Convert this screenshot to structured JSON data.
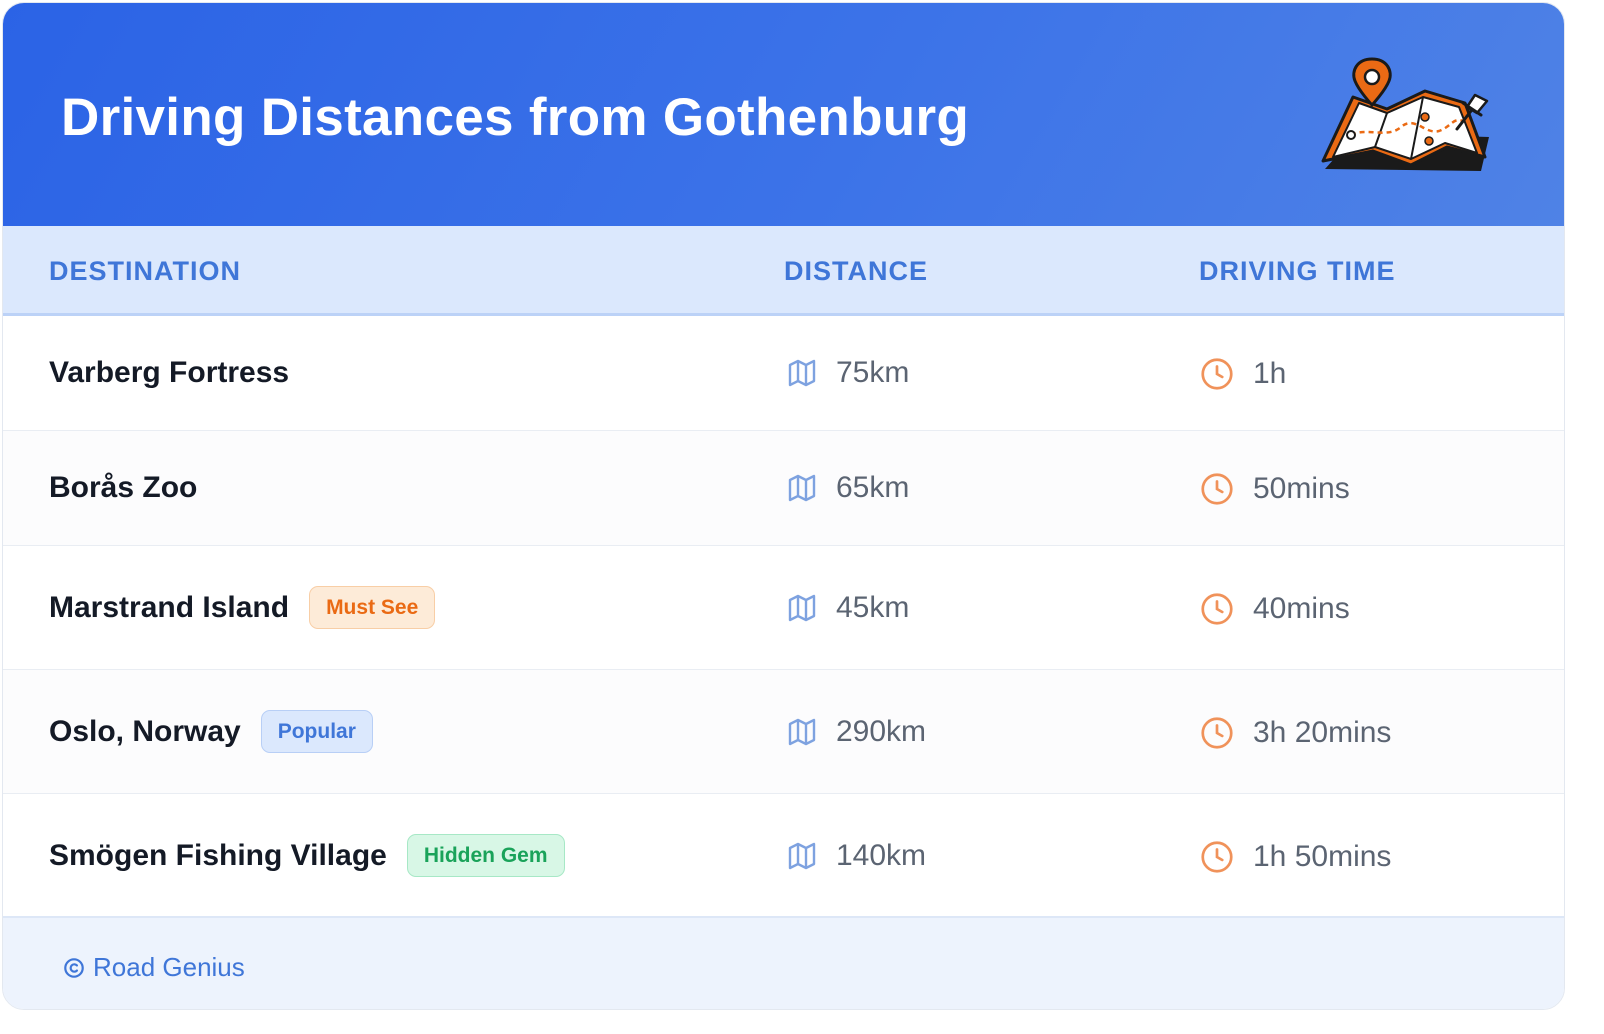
{
  "header": {
    "title": "Driving Distances from Gothenburg",
    "illustration": "map-with-pin-icon"
  },
  "table": {
    "columns": [
      "DESTINATION",
      "DISTANCE",
      "DRIVING TIME"
    ],
    "rows": [
      {
        "destination": "Varberg Fortress",
        "badge": "",
        "distance": "75km",
        "time": "1h"
      },
      {
        "destination": "Borås Zoo",
        "badge": "",
        "distance": "65km",
        "time": "50mins"
      },
      {
        "destination": "Marstrand Island",
        "badge": "Must See",
        "distance": "45km",
        "time": "40mins"
      },
      {
        "destination": "Oslo, Norway",
        "badge": "Popular",
        "distance": "290km",
        "time": "3h 20mins"
      },
      {
        "destination": "Smögen Fishing Village",
        "badge": "Hidden Gem",
        "distance": "140km",
        "time": "1h 50mins"
      }
    ],
    "icons": {
      "distance": "map-icon",
      "time": "clock-icon"
    }
  },
  "footer": {
    "text": "Road Genius",
    "icon": "copyright-icon"
  },
  "colors": {
    "header_gradient_start": "#2b63e6",
    "header_gradient_end": "#4f82e6",
    "accent_blue": "#3f76d8",
    "accent_orange": "#ea6a14",
    "accent_green": "#1aa35a"
  }
}
